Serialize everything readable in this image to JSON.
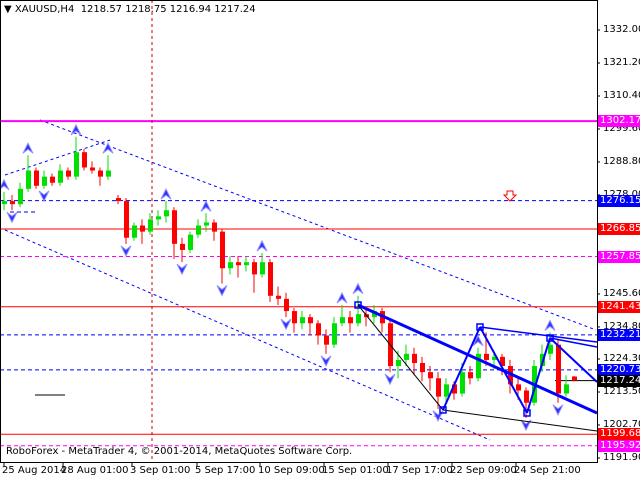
{
  "window": {
    "title_symbol": "XAUUSD,H4",
    "title_ohlc": "1218.57 1218.75 1216.94 1217.24",
    "footer": "RoboForex - MetaTrader 4, © 2001-2014, MetaQuotes Software Corp."
  },
  "chart_data": {
    "type": "candlestick",
    "symbol": "XAUUSD",
    "timeframe": "H4",
    "ylim": [
      1191.9,
      1332.0
    ],
    "grid": false,
    "y_ticks": [
      "1332.00",
      "1321.20",
      "1310.40",
      "1299.60",
      "1288.80",
      "1278.00",
      "1245.60",
      "1234.80",
      "1224.30",
      "1213.50",
      "1202.70",
      "1191.90"
    ],
    "x_ticks": [
      "25 Aug 2014",
      "28 Aug 01:00",
      "3 Sep 01:00",
      "5 Sep 17:00",
      "10 Sep 09:00",
      "15 Sep 01:00",
      "17 Sep 17:00",
      "22 Sep 09:00",
      "24 Sep 21:00"
    ],
    "ohlc": [
      [
        1275,
        1279,
        1273,
        1276
      ],
      [
        1276,
        1278,
        1273,
        1275
      ],
      [
        1275,
        1282,
        1274,
        1280
      ],
      [
        1280,
        1291,
        1279,
        1286
      ],
      [
        1286,
        1287,
        1280,
        1281
      ],
      [
        1281,
        1286,
        1280,
        1284
      ],
      [
        1284,
        1285,
        1281,
        1282
      ],
      [
        1282,
        1288,
        1281,
        1286
      ],
      [
        1286,
        1287,
        1283,
        1284
      ],
      [
        1284,
        1297,
        1283,
        1292
      ],
      [
        1292,
        1293,
        1286,
        1287
      ],
      [
        1287,
        1289,
        1285,
        1286
      ],
      [
        1286,
        1287,
        1281,
        1284
      ],
      [
        1284,
        1291,
        1283,
        1286
      ],
      [
        1277,
        1278,
        1275,
        1276
      ],
      [
        1276,
        1277,
        1262,
        1264
      ],
      [
        1264,
        1269,
        1263,
        1268
      ],
      [
        1268,
        1270,
        1262,
        1266
      ],
      [
        1266,
        1272,
        1265,
        1270
      ],
      [
        1270,
        1273,
        1268,
        1271
      ],
      [
        1271,
        1276,
        1269,
        1273
      ],
      [
        1273,
        1274,
        1257,
        1262
      ],
      [
        1262,
        1264,
        1256,
        1260
      ],
      [
        1260,
        1266,
        1259,
        1265
      ],
      [
        1265,
        1270,
        1264,
        1268
      ],
      [
        1268,
        1272,
        1266,
        1269
      ],
      [
        1269,
        1270,
        1263,
        1266
      ],
      [
        1266,
        1267,
        1249,
        1254
      ],
      [
        1254,
        1258,
        1252,
        1256
      ],
      [
        1256,
        1258,
        1251,
        1255
      ],
      [
        1255,
        1258,
        1253,
        1256
      ],
      [
        1256,
        1257,
        1246,
        1252
      ],
      [
        1252,
        1259,
        1251,
        1256
      ],
      [
        1256,
        1257,
        1243,
        1245
      ],
      [
        1245,
        1248,
        1242,
        1244
      ],
      [
        1244,
        1246,
        1238,
        1240
      ],
      [
        1240,
        1241,
        1233,
        1236
      ],
      [
        1236,
        1240,
        1234,
        1238
      ],
      [
        1238,
        1239,
        1232,
        1236
      ],
      [
        1236,
        1237,
        1229,
        1232
      ],
      [
        1232,
        1234,
        1226,
        1229
      ],
      [
        1229,
        1238,
        1228,
        1236
      ],
      [
        1236,
        1242,
        1235,
        1238
      ],
      [
        1238,
        1240,
        1233,
        1236
      ],
      [
        1236,
        1245,
        1235,
        1239
      ],
      [
        1239,
        1241,
        1235,
        1238
      ],
      [
        1238,
        1242,
        1236,
        1240
      ],
      [
        1240,
        1241,
        1233,
        1236
      ],
      [
        1236,
        1237,
        1220,
        1222
      ],
      [
        1222,
        1227,
        1218,
        1224
      ],
      [
        1224,
        1229,
        1222,
        1226
      ],
      [
        1226,
        1228,
        1219,
        1223
      ],
      [
        1223,
        1225,
        1217,
        1220
      ],
      [
        1220,
        1222,
        1214,
        1218
      ],
      [
        1218,
        1220,
        1208,
        1212
      ],
      [
        1212,
        1218,
        1210,
        1216
      ],
      [
        1216,
        1217,
        1211,
        1213
      ],
      [
        1213,
        1223,
        1212,
        1220
      ],
      [
        1220,
        1222,
        1216,
        1218
      ],
      [
        1218,
        1228,
        1217,
        1226
      ],
      [
        1226,
        1233,
        1222,
        1224
      ],
      [
        1224,
        1227,
        1221,
        1225
      ],
      [
        1225,
        1226,
        1219,
        1222
      ],
      [
        1222,
        1224,
        1213,
        1216
      ],
      [
        1216,
        1218,
        1211,
        1214
      ],
      [
        1214,
        1215,
        1205,
        1210
      ],
      [
        1210,
        1224,
        1209,
        1222
      ],
      [
        1222,
        1229,
        1220,
        1226
      ],
      [
        1226,
        1233,
        1224,
        1229
      ],
      [
        1229,
        1231,
        1210,
        1213
      ],
      [
        1213,
        1219,
        1212,
        1216
      ],
      [
        1218.57,
        1218.75,
        1216.94,
        1217.24
      ]
    ],
    "fractals_up": [
      0,
      3,
      9,
      13,
      20,
      25,
      32,
      42,
      44,
      59,
      68
    ],
    "fractals_down": [
      1,
      5,
      15,
      22,
      27,
      35,
      40,
      48,
      54,
      65,
      69
    ],
    "levels": [
      {
        "price": "1302.17",
        "color": "#ff00ff",
        "style": "solid"
      },
      {
        "price": "1276.15",
        "color": "#0000ff",
        "style": "dashed"
      },
      {
        "price": "1266.85",
        "color": "#ff0000",
        "style": "solid"
      },
      {
        "price": "1257.85",
        "color": "#ff00ff",
        "style": "dashed"
      },
      {
        "price": "1241.43",
        "color": "#ff0000",
        "style": "solid"
      },
      {
        "price": "1232.21",
        "color": "#0000ff",
        "style": "dashed"
      },
      {
        "price": "1220.73",
        "color": "#0000ff",
        "style": "dashed"
      },
      {
        "price": "1217.24",
        "color": "#000000",
        "style": "bid"
      },
      {
        "price": "1199.68",
        "color": "#ff0000",
        "style": "solid"
      },
      {
        "price": "1195.92",
        "color": "#ff00ff",
        "style": "dashed"
      }
    ],
    "colors": {
      "bull": "#00e000",
      "bear": "#ff0000",
      "background": "#ffffff",
      "lines": "#0000ff"
    }
  }
}
